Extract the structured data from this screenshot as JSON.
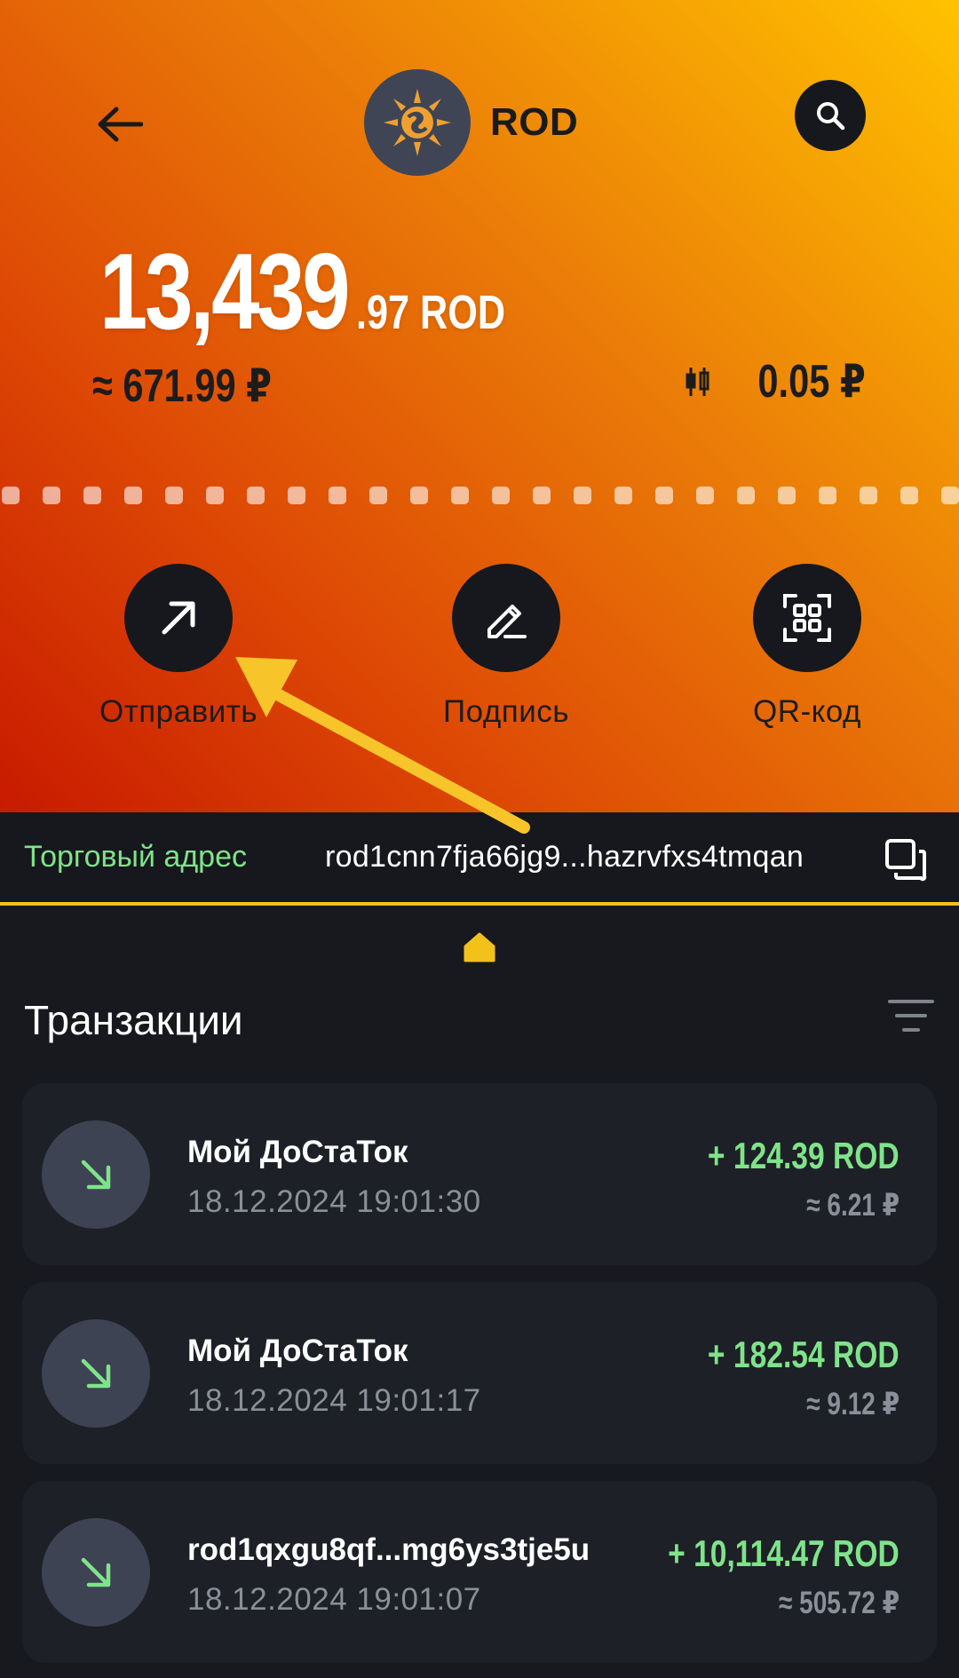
{
  "header": {
    "coin_name": "ROD",
    "balance_integer": "13,439",
    "balance_decimal": ".97 ROD",
    "fiat_value": "≈ 671.99 ₽",
    "price": "0.05 ₽"
  },
  "actions": [
    {
      "label": "Отправить",
      "icon": "arrow-up-right-icon"
    },
    {
      "label": "Подпись",
      "icon": "pen-icon"
    },
    {
      "label": "QR-код",
      "icon": "qr-scan-icon"
    }
  ],
  "address": {
    "label": "Торговый адрес",
    "value": "rod1cnn7fja66jg9...hazrvfxs4tmqan"
  },
  "transactions": {
    "title": "Транзакции",
    "items": [
      {
        "name": "Мой ДоСтаТок",
        "date": "18.12.2024 19:01:30",
        "amount": "+ 124.39 ROD",
        "fiat": "≈ 6.21 ₽"
      },
      {
        "name": "Мой ДоСтаТок",
        "date": "18.12.2024 19:01:17",
        "amount": "+ 182.54 ROD",
        "fiat": "≈ 9.12 ₽"
      },
      {
        "name": "rod1qxgu8qf...mg6ys3tje5u",
        "date": "18.12.2024 19:01:07",
        "amount": "+ 10,114.47 ROD",
        "fiat": "≈ 505.72 ₽"
      }
    ]
  },
  "colors": {
    "accent_green": "#7fe38a",
    "accent_yellow": "#f2c21a",
    "card_bg": "#1d2027",
    "page_bg": "#17191e"
  }
}
